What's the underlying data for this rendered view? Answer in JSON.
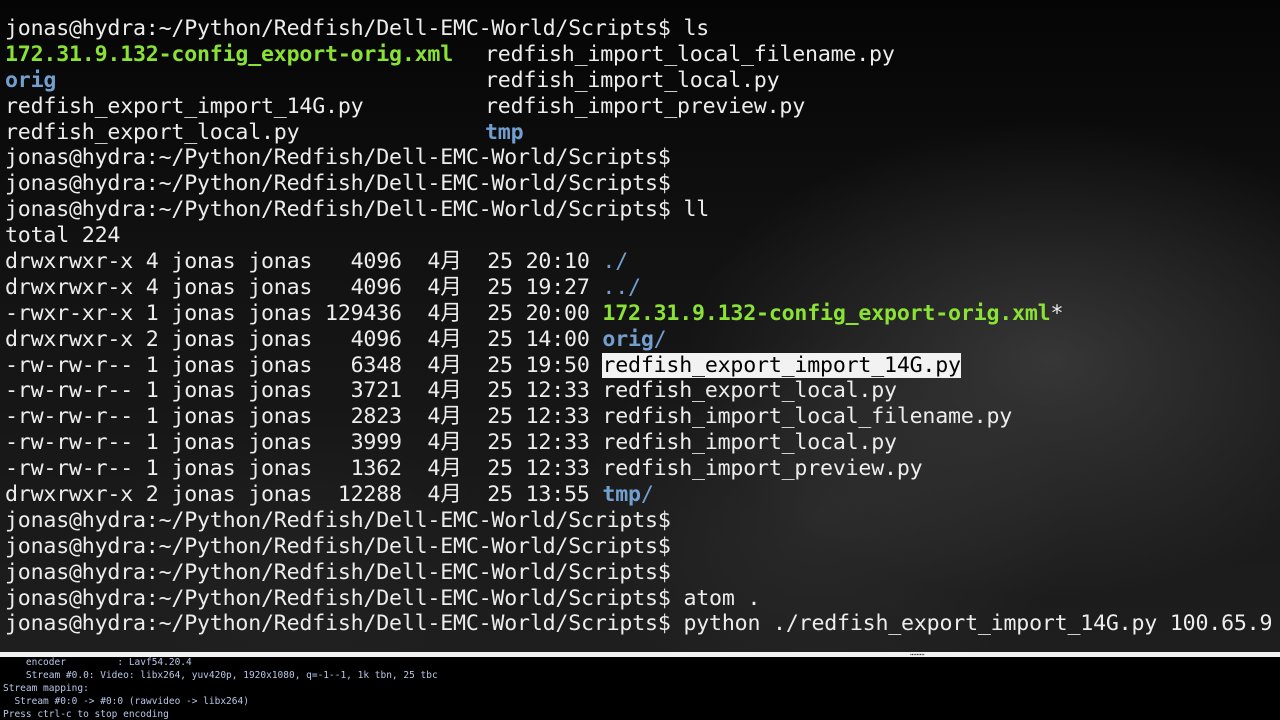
{
  "terminal": {
    "prompt": "jonas@hydra:~/Python/Redfish/Dell-EMC-World/Scripts$",
    "ls": {
      "command": "ls",
      "col1": [
        {
          "name": "172.31.9.132-config_export-orig.xml",
          "type": "exec"
        },
        {
          "name": "orig",
          "type": "dir"
        },
        {
          "name": "redfish_export_import_14G.py",
          "type": "file"
        },
        {
          "name": "redfish_export_local.py",
          "type": "file"
        }
      ],
      "col2": [
        {
          "name": "redfish_import_local_filename.py",
          "type": "file"
        },
        {
          "name": "redfish_import_local.py",
          "type": "file"
        },
        {
          "name": "redfish_import_preview.py",
          "type": "file"
        },
        {
          "name": "tmp",
          "type": "dir"
        }
      ]
    },
    "ll": {
      "command": "ll",
      "total": "total 224",
      "rows": [
        {
          "info": "drwxrwxr-x 4 jonas jonas   4096  4月  25 20:10 ",
          "name": "./",
          "type": "dir-plain",
          "suffix": ""
        },
        {
          "info": "drwxrwxr-x 4 jonas jonas   4096  4月  25 19:27 ",
          "name": "../",
          "type": "dir-plain",
          "suffix": ""
        },
        {
          "info": "-rwxr-xr-x 1 jonas jonas 129436  4月  25 20:00 ",
          "name": "172.31.9.132-config_export-orig.xml",
          "type": "exec",
          "suffix": "*"
        },
        {
          "info": "drwxrwxr-x 2 jonas jonas   4096  4月  25 14:00 ",
          "name": "orig",
          "type": "dir",
          "suffix": "/"
        },
        {
          "info": "-rw-rw-r-- 1 jonas jonas   6348  4月  25 19:50 ",
          "name": "redfish_export_import_14G.py",
          "type": "selected",
          "suffix": ""
        },
        {
          "info": "-rw-rw-r-- 1 jonas jonas   3721  4月  25 12:33 ",
          "name": "redfish_export_local.py",
          "type": "file",
          "suffix": ""
        },
        {
          "info": "-rw-rw-r-- 1 jonas jonas   2823  4月  25 12:33 ",
          "name": "redfish_import_local_filename.py",
          "type": "file",
          "suffix": ""
        },
        {
          "info": "-rw-rw-r-- 1 jonas jonas   3999  4月  25 12:33 ",
          "name": "redfish_import_local.py",
          "type": "file",
          "suffix": ""
        },
        {
          "info": "-rw-rw-r-- 1 jonas jonas   1362  4月  25 12:33 ",
          "name": "redfish_import_preview.py",
          "type": "file",
          "suffix": ""
        },
        {
          "info": "drwxrwxr-x 2 jonas jonas  12288  4月  25 13:55 ",
          "name": "tmp",
          "type": "dir",
          "suffix": "/"
        }
      ]
    },
    "atom_command": "atom .",
    "python_command": "python ./redfish_export_import_14G.py 100.65.9"
  },
  "encoder": {
    "lines": [
      "    encoder         : Lavf54.20.4",
      "    Stream #0.0: Video: libx264, yuv420p, 1920x1080, q=-1--1, 1k tbn, 25 tbc",
      "Stream mapping:",
      "  Stream #0:0 -> #0:0 (rawvideo -> libx264)",
      "Press ctrl-c to stop encoding"
    ]
  }
}
